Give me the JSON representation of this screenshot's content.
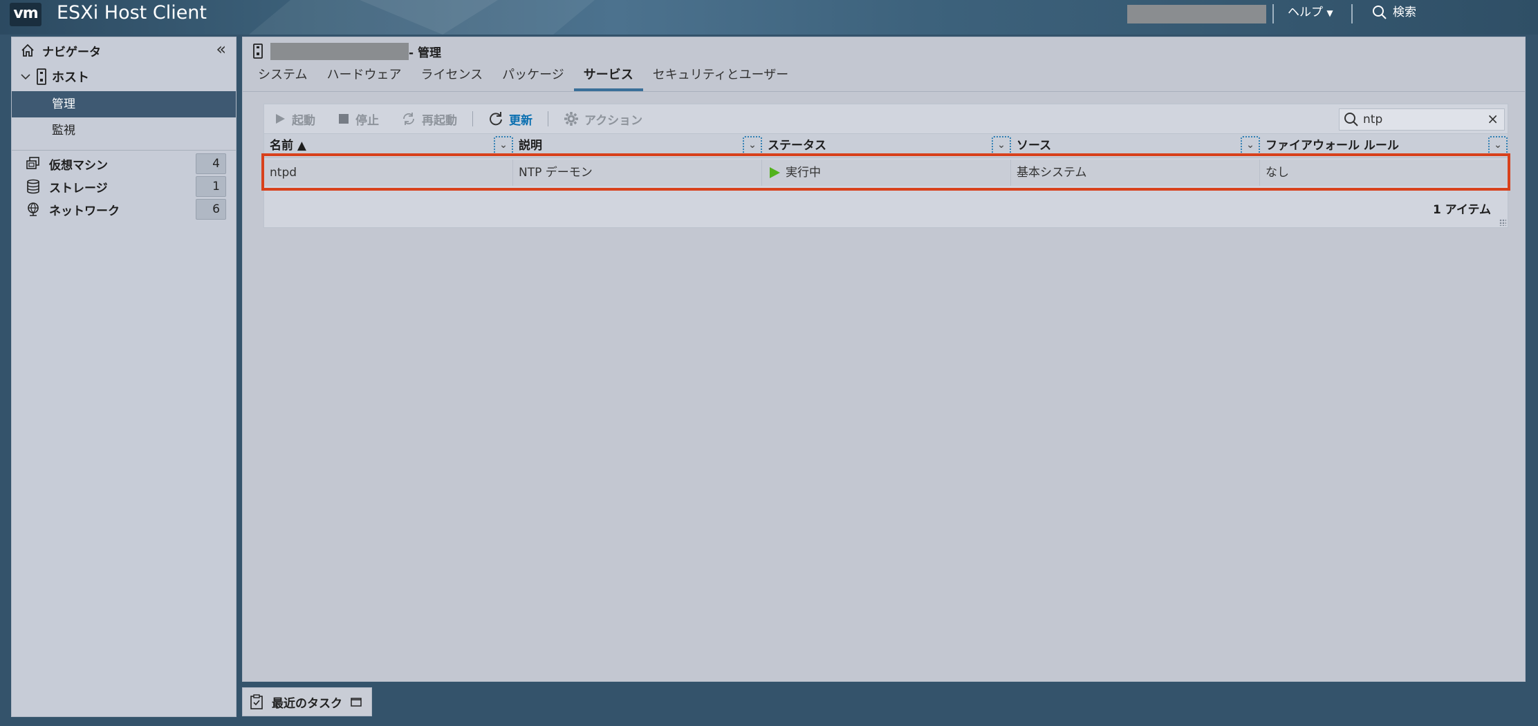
{
  "header": {
    "logo": "vm",
    "title": "ESXi Host Client",
    "help_label": "ヘルプ",
    "search_label": "検索"
  },
  "navigator": {
    "title": "ナビゲータ",
    "host_label": "ホスト",
    "host_children": [
      {
        "label": "管理",
        "selected": true
      },
      {
        "label": "監視",
        "selected": false
      }
    ],
    "inventory": [
      {
        "label": "仮想マシン",
        "count": "4",
        "icon": "vm-icon"
      },
      {
        "label": "ストレージ",
        "count": "1",
        "icon": "storage-icon"
      },
      {
        "label": "ネットワーク",
        "count": "6",
        "icon": "network-icon"
      }
    ]
  },
  "main": {
    "title_suffix": "- 管理",
    "tabs": [
      "システム",
      "ハードウェア",
      "ライセンス",
      "パッケージ",
      "サービス",
      "セキュリティとユーザー"
    ],
    "active_tab": "サービス"
  },
  "toolbar": {
    "start_label": "起動",
    "stop_label": "停止",
    "restart_label": "再起動",
    "refresh_label": "更新",
    "actions_label": "アクション",
    "search_value": "ntp"
  },
  "grid": {
    "columns": [
      "名前 ▲",
      "説明",
      "ステータス",
      "ソース",
      "ファイアウォール ルール"
    ],
    "rows": [
      [
        "ntpd",
        "NTP デーモン",
        "実行中",
        "基本システム",
        "なし"
      ]
    ],
    "item_count": "1 アイテム"
  },
  "recent_tasks": {
    "label": "最近のタスク"
  },
  "colors": {
    "accent": "#0a6fb0",
    "highlight": "#d8411c",
    "running": "#52b21c"
  }
}
